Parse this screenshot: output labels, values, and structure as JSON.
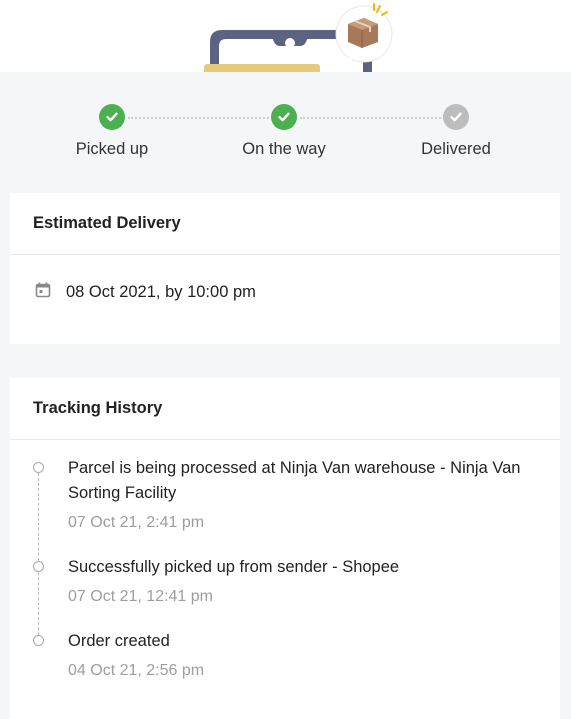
{
  "progress": {
    "steps": [
      {
        "label": "Picked up",
        "state": "done"
      },
      {
        "label": "On the way",
        "state": "done"
      },
      {
        "label": "Delivered",
        "state": "pending"
      }
    ]
  },
  "estimated_delivery": {
    "title": "Estimated Delivery",
    "datetime": "08 Oct 2021, by 10:00 pm",
    "icon": "calendar-icon"
  },
  "tracking_history": {
    "title": "Tracking History",
    "events": [
      {
        "text": "Parcel is being processed at Ninja Van warehouse - Ninja Van Sorting Facility",
        "time": "07 Oct 21, 2:41 pm"
      },
      {
        "text": "Successfully picked up from sender - Shopee",
        "time": "07 Oct 21, 12:41 pm"
      },
      {
        "text": "Order created",
        "time": "04 Oct 21, 2:56 pm"
      }
    ]
  },
  "colors": {
    "done": "#4caf50",
    "pending": "#bdbdbd",
    "muted_text": "#9e9e9e"
  }
}
